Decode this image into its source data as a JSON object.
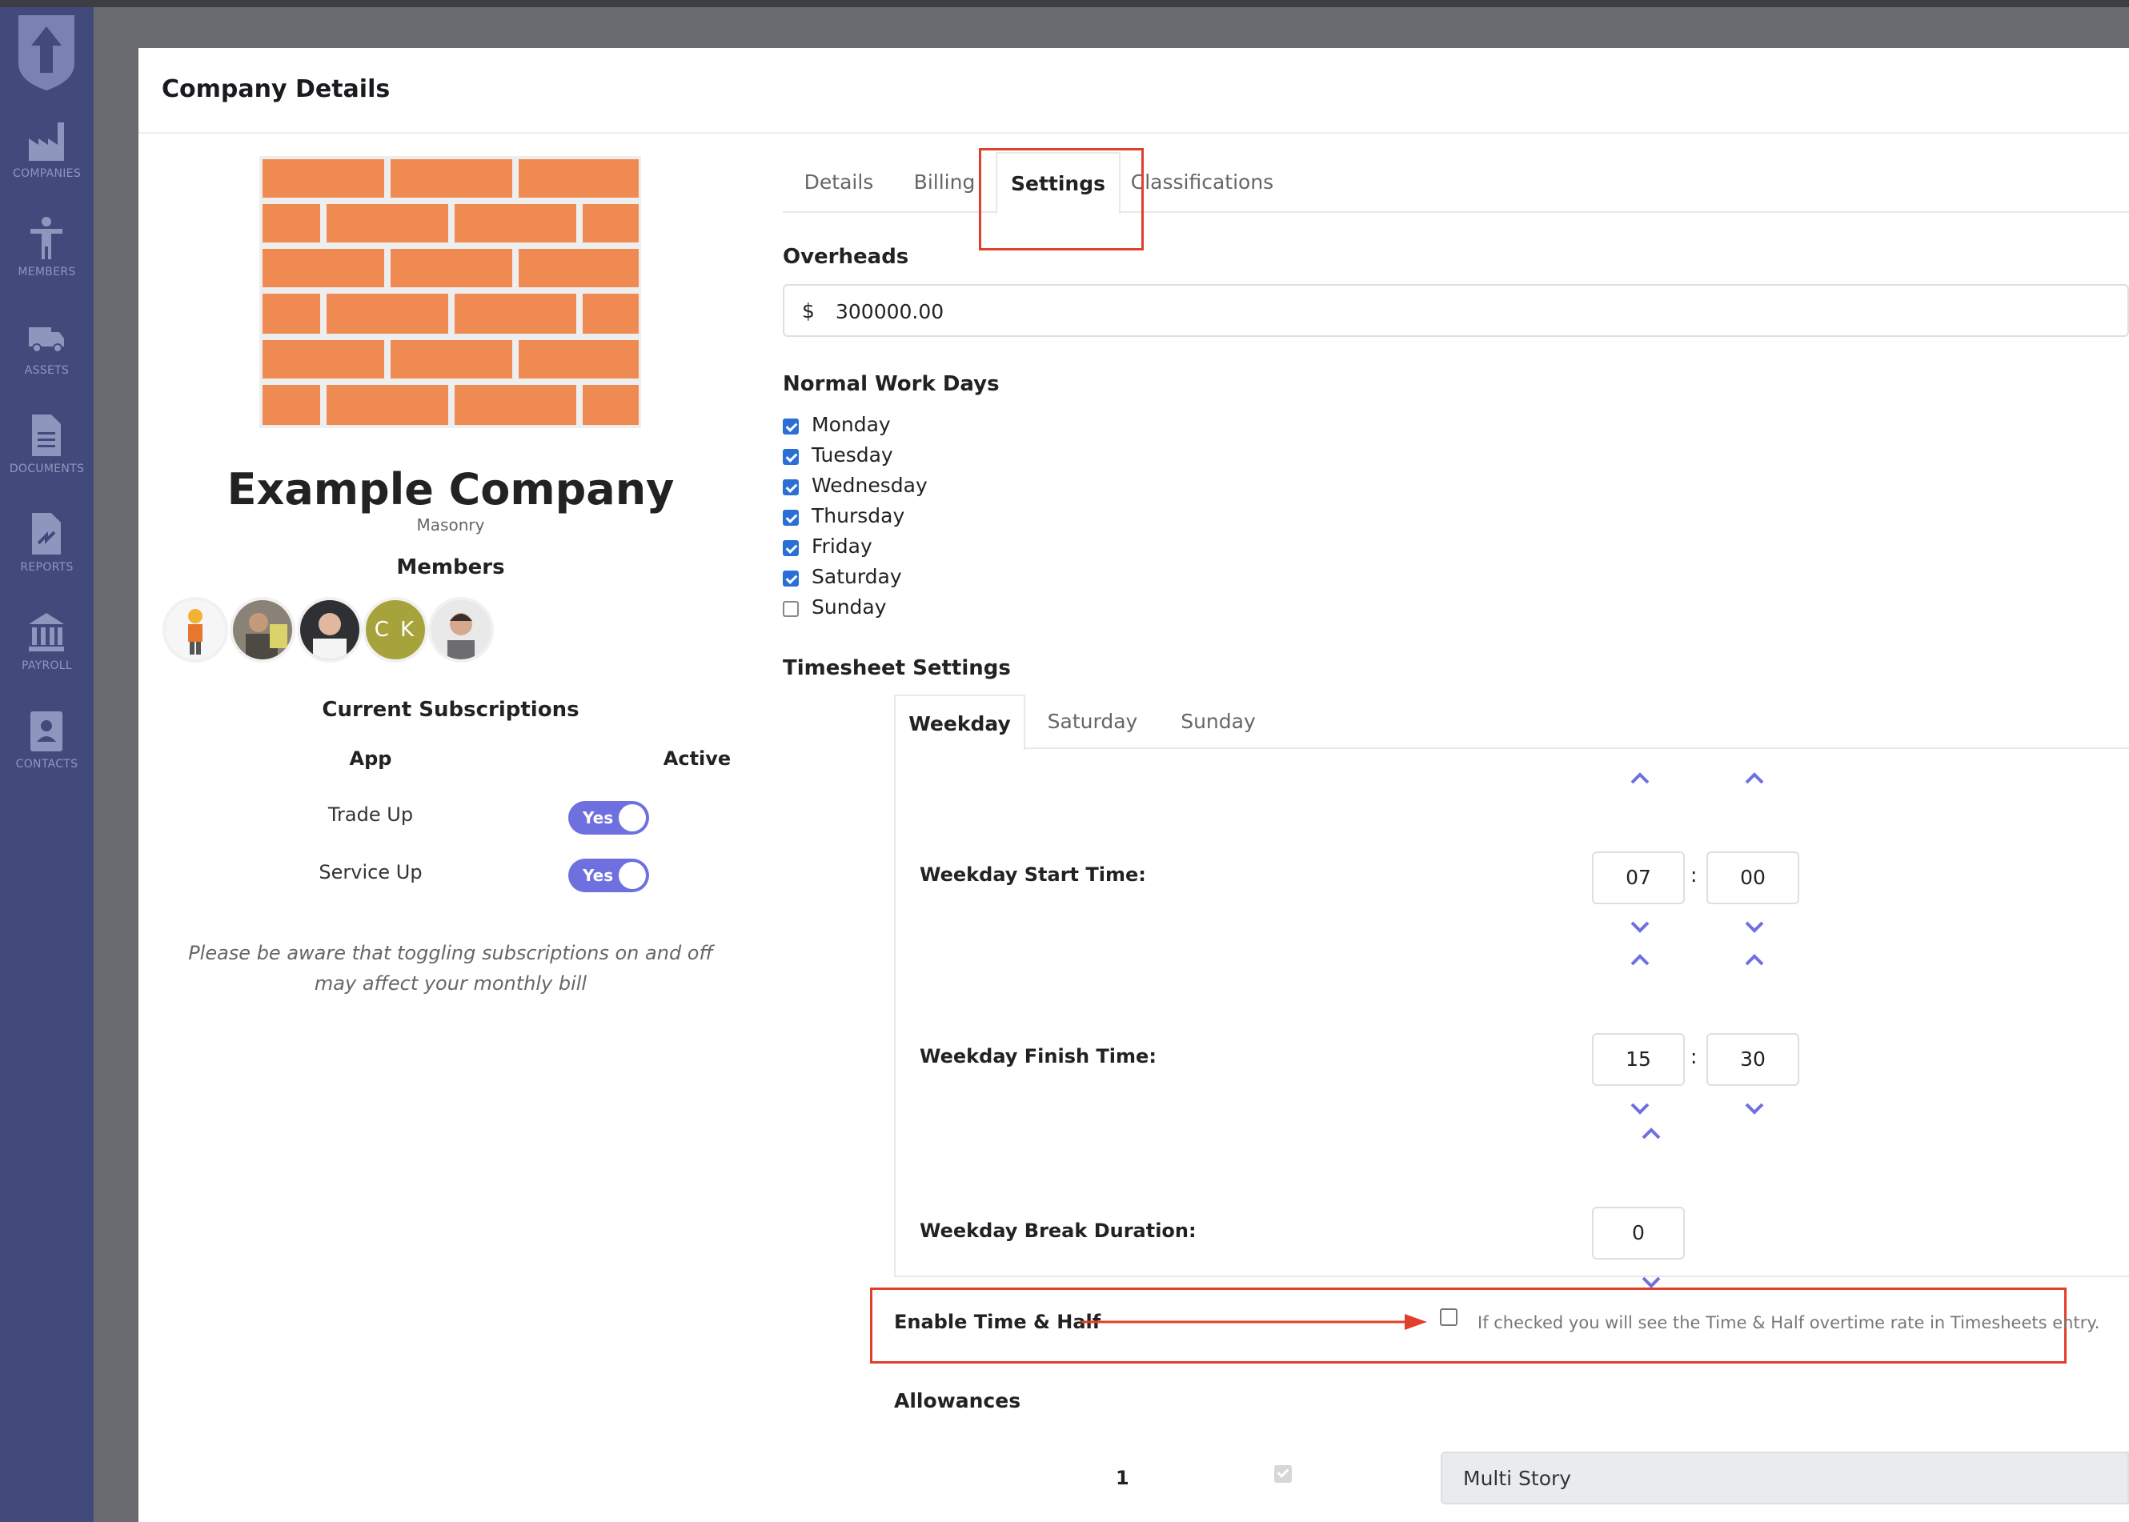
{
  "sidebar": {
    "items": [
      {
        "label": "COMPANIES",
        "icon": "factory-icon"
      },
      {
        "label": "MEMBERS",
        "icon": "person-icon"
      },
      {
        "label": "ASSETS",
        "icon": "truck-icon"
      },
      {
        "label": "DOCUMENTS",
        "icon": "document-icon"
      },
      {
        "label": "REPORTS",
        "icon": "report-icon"
      },
      {
        "label": "PAYROLL",
        "icon": "bank-icon"
      },
      {
        "label": "CONTACTS",
        "icon": "contact-card-icon"
      }
    ]
  },
  "modal": {
    "title": "Company Details"
  },
  "company": {
    "name": "Example Company",
    "trade": "Masonry",
    "members_heading": "Members",
    "member_initials": "C K"
  },
  "subscriptions": {
    "heading": "Current Subscriptions",
    "col_app": "App",
    "col_active": "Active",
    "rows": [
      {
        "app": "Trade Up",
        "active": "Yes"
      },
      {
        "app": "Service Up",
        "active": "Yes"
      }
    ],
    "note": "Please be aware that toggling subscriptions on and off may affect your monthly bill"
  },
  "tabs": [
    {
      "label": "Details",
      "active": false
    },
    {
      "label": "Billing",
      "active": false
    },
    {
      "label": "Settings",
      "active": true
    },
    {
      "label": "Classifications",
      "active": false
    }
  ],
  "settings": {
    "overheads": {
      "heading": "Overheads",
      "prefix": "$",
      "value": "300000.00"
    },
    "work_days": {
      "heading": "Normal Work Days",
      "days": [
        {
          "label": "Monday",
          "checked": true
        },
        {
          "label": "Tuesday",
          "checked": true
        },
        {
          "label": "Wednesday",
          "checked": true
        },
        {
          "label": "Thursday",
          "checked": true
        },
        {
          "label": "Friday",
          "checked": true
        },
        {
          "label": "Saturday",
          "checked": true
        },
        {
          "label": "Sunday",
          "checked": false
        }
      ]
    },
    "timesheet": {
      "heading": "Timesheet Settings",
      "tabs": [
        {
          "label": "Weekday",
          "active": true
        },
        {
          "label": "Saturday",
          "active": false
        },
        {
          "label": "Sunday",
          "active": false
        }
      ],
      "start": {
        "label": "Weekday Start Time:",
        "hour": "07",
        "minute": "00"
      },
      "finish": {
        "label": "Weekday Finish Time:",
        "hour": "15",
        "minute": "30"
      },
      "break": {
        "label": "Weekday Break Duration:",
        "value": "0"
      },
      "colon": ":"
    },
    "time_and_half": {
      "label": "Enable Time & Half",
      "checked": false,
      "help": "If checked you will see the Time & Half overtime rate in Timesheets entry."
    },
    "allowances": {
      "heading": "Allowances",
      "rows": [
        {
          "index": "1",
          "checked": true,
          "name": "Multi Story"
        }
      ]
    }
  },
  "colors": {
    "sidebar": "#424a7c",
    "accent": "#6f70e0",
    "checkbox": "#2a6fd6",
    "highlight": "#e0402b",
    "initials_avatar": "#a7a33c"
  }
}
